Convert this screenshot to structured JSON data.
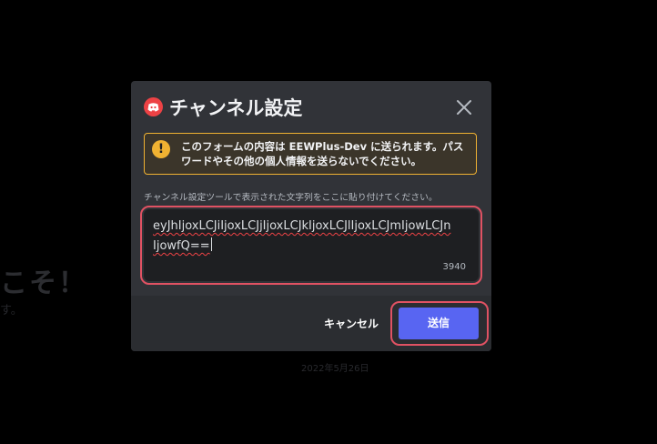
{
  "background": {
    "heading": "こそ！",
    "subtext": "す。",
    "date": "2022年5月26日"
  },
  "modal": {
    "title": "チャンネル設定",
    "logo_icon": "discord-logo-icon",
    "close_icon": "close-icon",
    "warning": {
      "icon": "exclamation-icon",
      "text": "このフォームの内容は EEWPlus-Dev に送られます。パスワードやその他の個人情報を送らないでください。"
    },
    "instruction": "チャンネル設定ツールで表示された文字列をここに貼り付けてください。",
    "input": {
      "value": "eyJhIjoxLCJiIjoxLCJjIjoxLCJkIjoxLCJlIjoxLCJmIjowLCJnIjowfQ==",
      "remaining": "3940"
    },
    "cancel_label": "キャンセル",
    "submit_label": "送信"
  },
  "colors": {
    "modal_bg": "#313338",
    "footer_bg": "#2b2d31",
    "input_bg": "#1e1f22",
    "warning": "#f0b232",
    "brand": "#5865f2",
    "logo": "#ed4245",
    "highlight": "#e05263"
  }
}
